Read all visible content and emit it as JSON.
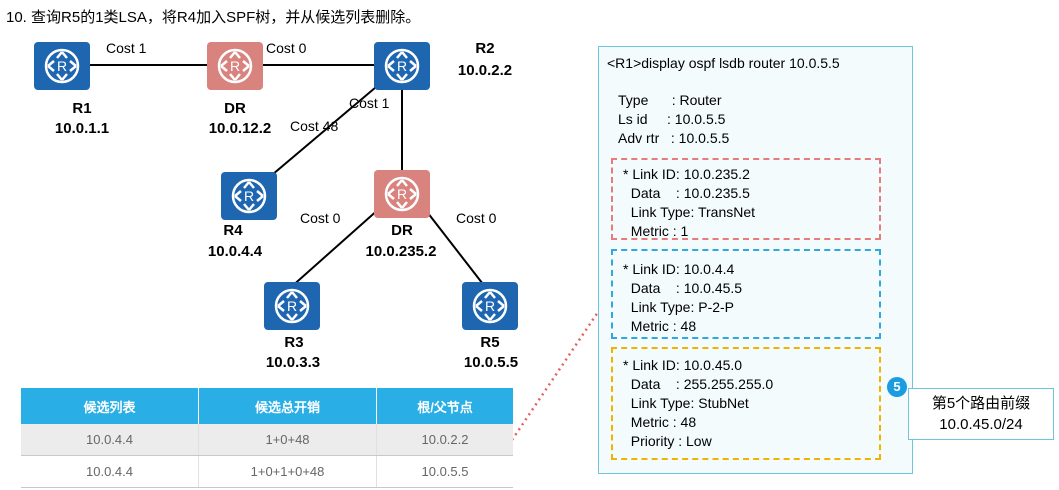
{
  "title": "10.  查询R5的1类LSA，将R4加入SPF树，并从候选列表删除。",
  "colors": {
    "router_blue": "#1f66b1",
    "router_dr": "#d9837f",
    "header_blue": "#2aaee6",
    "box_red": "#e67c7c",
    "box_blue": "#2ea8dd",
    "box_yellow": "#f0b400"
  },
  "routers": {
    "r1": {
      "name": "R1",
      "id": "10.0.1.1"
    },
    "dr1": {
      "name": "DR",
      "id": "10.0.12.2"
    },
    "r2": {
      "name": "R2",
      "id": "10.0.2.2"
    },
    "r4": {
      "name": "R4",
      "id": "10.0.4.4"
    },
    "dr2": {
      "name": "DR",
      "id": "10.0.235.2"
    },
    "r3": {
      "name": "R3",
      "id": "10.0.3.3"
    },
    "r5": {
      "name": "R5",
      "id": "10.0.5.5"
    }
  },
  "costs": {
    "r1_dr1": "Cost 1",
    "dr1_r2": "Cost 0",
    "r2_dr2": "Cost 1",
    "r2_r4": "Cost 48",
    "dr2_r3": "Cost 0",
    "dr2_r5": "Cost 0"
  },
  "candidate_table": {
    "headers": [
      "候选列表",
      "候选总开销",
      "根/父节点"
    ],
    "rows": [
      [
        "10.0.4.4",
        "1+0+48",
        "10.0.2.2"
      ],
      [
        "10.0.4.4",
        "1+0+1+0+48",
        "10.0.5.5"
      ]
    ]
  },
  "lsdb": {
    "command": "<R1>display ospf lsdb router 10.0.5.5",
    "header_lines": [
      "Type      : Router",
      "Ls id     : 10.0.5.5",
      "Adv rtr   : 10.0.5.5"
    ],
    "links": [
      [
        "* Link ID: 10.0.235.2",
        "  Data    : 10.0.235.5",
        "  Link Type: TransNet",
        "  Metric : 1"
      ],
      [
        "* Link ID: 10.0.4.4",
        "  Data    : 10.0.45.5",
        "  Link Type: P-2-P",
        "  Metric : 48"
      ],
      [
        "* Link ID: 10.0.45.0",
        "  Data    : 255.255.255.0",
        "  Link Type: StubNet",
        "  Metric : 48",
        "  Priority : Low"
      ]
    ]
  },
  "callout": {
    "badge": "5",
    "line1": "第5个路由前缀",
    "line2": "10.0.45.0/24"
  },
  "router_icon": "router-icon"
}
